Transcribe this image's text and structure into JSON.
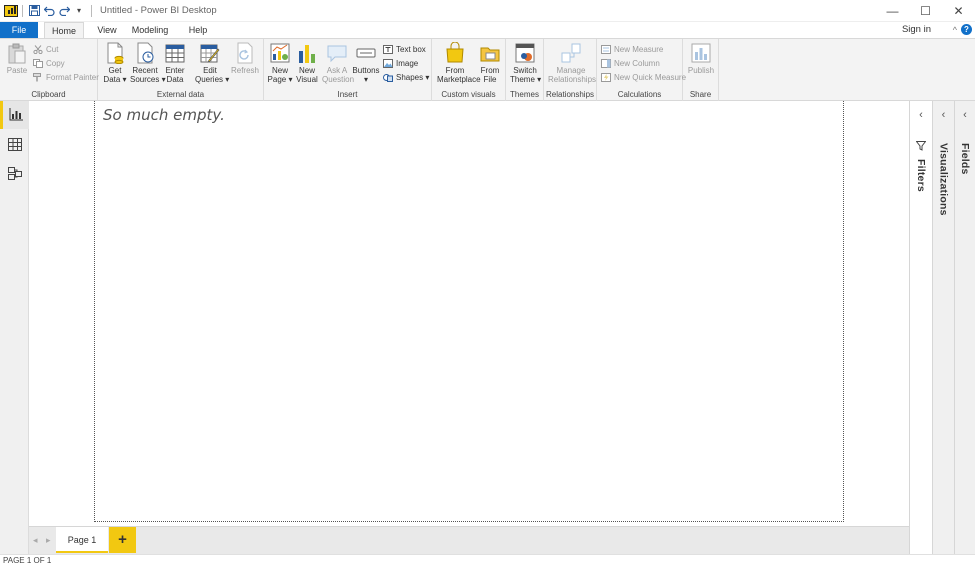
{
  "window": {
    "title": "Untitled - Power BI Desktop",
    "minimize_glyph": "—",
    "maximize_glyph": "☐",
    "close_glyph": "✕"
  },
  "quick_access": {
    "customize_glyph": "▾"
  },
  "tabs": {
    "file": "File",
    "home": "Home",
    "view": "View",
    "modeling": "Modeling",
    "help": "Help"
  },
  "account": {
    "signin": "Sign in",
    "collapse_glyph": "^",
    "help_glyph": "?"
  },
  "ribbon": {
    "clipboard": {
      "label": "Clipboard",
      "paste": "Paste",
      "cut": "Cut",
      "copy": "Copy",
      "format_painter": "Format Painter"
    },
    "external_data": {
      "label": "External data",
      "get_data": [
        "Get",
        "Data ▾"
      ],
      "recent_sources": [
        "Recent",
        "Sources ▾"
      ],
      "enter_data": [
        "Enter",
        "Data"
      ],
      "edit_queries": [
        "Edit",
        "Queries ▾"
      ],
      "refresh": "Refresh"
    },
    "insert": {
      "label": "Insert",
      "new_page": [
        "New",
        "Page ▾"
      ],
      "new_visual": [
        "New",
        "Visual"
      ],
      "ask_question": [
        "Ask A",
        "Question"
      ],
      "buttons": [
        "Buttons",
        "▾"
      ],
      "text_box": "Text box",
      "image": "Image",
      "shapes": "Shapes ▾"
    },
    "custom_visuals": {
      "label": "Custom visuals",
      "from_marketplace": [
        "From",
        "Marketplace"
      ],
      "from_file": [
        "From",
        "File"
      ]
    },
    "themes": {
      "label": "Themes",
      "switch_theme": [
        "Switch",
        "Theme ▾"
      ]
    },
    "relationships": {
      "label": "Relationships",
      "manage": [
        "Manage",
        "Relationships"
      ]
    },
    "calculations": {
      "label": "Calculations",
      "new_measure": "New Measure",
      "new_column": "New Column",
      "new_quick_measure": "New Quick Measure"
    },
    "share": {
      "label": "Share",
      "publish": "Publish"
    }
  },
  "canvas": {
    "empty_text": "So much empty."
  },
  "pages": {
    "tabs": [
      "Page 1"
    ],
    "add_glyph": "+",
    "prev_glyph": "◂",
    "next_glyph": "▸"
  },
  "panes": {
    "filters": "Filters",
    "visualizations": "Visualizations",
    "fields": "Fields",
    "collapse_glyph": "‹"
  },
  "status": {
    "text": "PAGE 1 OF 1"
  },
  "colors": {
    "accent_yellow": "#F2C811",
    "file_blue": "#1170C9"
  }
}
